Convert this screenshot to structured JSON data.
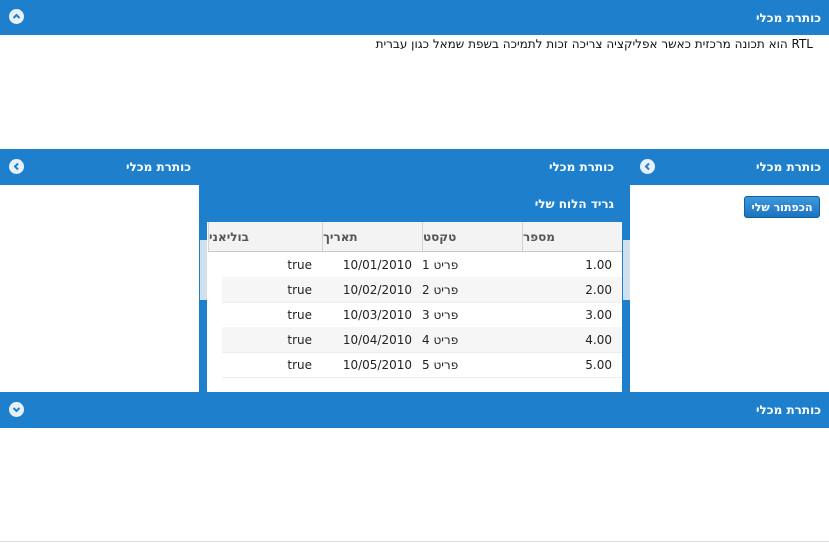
{
  "top_panel": {
    "title": "כותרת מכלי",
    "text": "RTL הוא תכונה מרכזית כאשר אפליקציה צריכה זכות לתמיכה בשפת שמאל כגון עברית"
  },
  "left_panel": {
    "title": "כותרת מכלי"
  },
  "center_panel": {
    "title": "כותרת מכלי",
    "grid": {
      "title": "גריד הלוח שלי",
      "columns": [
        "מספר",
        "טקסט",
        "תאריך",
        "בוליאני"
      ],
      "rows": [
        {
          "number": "1.00",
          "text": "פריט 1",
          "date": "10/01/2010",
          "bool": "true"
        },
        {
          "number": "2.00",
          "text": "פריט 2",
          "date": "10/02/2010",
          "bool": "true"
        },
        {
          "number": "3.00",
          "text": "פריט 3",
          "date": "10/03/2010",
          "bool": "true"
        },
        {
          "number": "4.00",
          "text": "פריט 4",
          "date": "10/04/2010",
          "bool": "true"
        },
        {
          "number": "5.00",
          "text": "פריט 5",
          "date": "10/05/2010",
          "bool": "true"
        }
      ]
    }
  },
  "right_panel": {
    "title": "כותרת מכלי",
    "button_label": "הכפתור שלי"
  },
  "bottom_panel": {
    "title": "כותרת מכלי"
  },
  "colors": {
    "header": "#1e80cc",
    "button": "#1c74bf"
  },
  "icons": {
    "top_tool": "chevron-up-icon",
    "left_tool": "chevron-left-icon",
    "right_tool": "chevron-left-icon",
    "bottom_tool": "chevron-down-icon"
  }
}
